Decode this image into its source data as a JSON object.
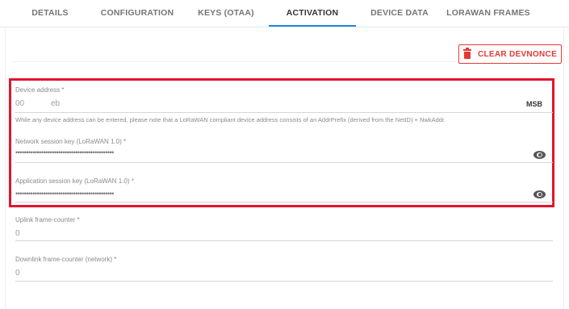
{
  "tabs": [
    {
      "label": "DETAILS"
    },
    {
      "label": "CONFIGURATION"
    },
    {
      "label": "KEYS (OTAA)"
    },
    {
      "label": "ACTIVATION"
    },
    {
      "label": "DEVICE DATA"
    },
    {
      "label": "LORAWAN FRAMES"
    }
  ],
  "active_tab": "ACTIVATION",
  "clear_devnonce": {
    "label": "CLEAR DEVNONCE",
    "icon": "trash-icon"
  },
  "device_address": {
    "label": "Device address *",
    "value_byte_1": "00",
    "value_byte_2": "eb",
    "byte_order": "MSB",
    "hint": "While any device address can be entered, please note that a LoRaWAN compliant device address consists of an AddrPrefix (derived from the NetID) + NwkAddr."
  },
  "network_session_key": {
    "label": "Network session key (LoRaWAN 1.0) *",
    "masked_value": "••••••••••••••••••••••••••••••••••••••••••••••",
    "icon": "eye-icon"
  },
  "application_session_key": {
    "label": "Application session key (LoRaWAN 1.0) *",
    "masked_value": "••••••••••••••••••••••••••••••••••••••••••••••",
    "icon": "eye-icon"
  },
  "uplink_frame_counter": {
    "label": "Uplink frame-counter *",
    "value": "0"
  },
  "downlink_frame_counter": {
    "label": "Downlink frame-counter (network) *",
    "value": "0"
  },
  "colors": {
    "accent": "#1e88e5",
    "danger": "#e53935",
    "highlight": "#e3142b"
  }
}
